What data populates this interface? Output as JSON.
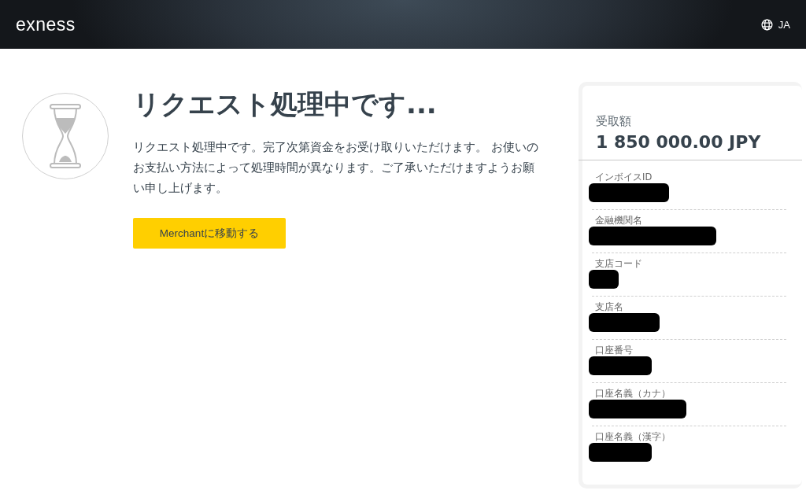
{
  "header": {
    "logo": "exness",
    "language": "JA"
  },
  "status": {
    "title": "リクエスト処理中です...",
    "message": "リクエスト処理中です。完了次第資金をお受け取りいただけます。 お使いのお支払い方法によって処理時間が異なります。ご了承いただけますようお願い申し上げます。",
    "button": "Merchantに移動する"
  },
  "receipt": {
    "amount_label": "受取額",
    "amount": "1 850 000.00 JPY",
    "fields": [
      {
        "label": "インボイスID"
      },
      {
        "label": "金融機関名"
      },
      {
        "label": "支店コード"
      },
      {
        "label": "支店名"
      },
      {
        "label": "口座番号"
      },
      {
        "label": "口座名義（カナ）"
      },
      {
        "label": "口座名義（漢字）"
      }
    ]
  }
}
